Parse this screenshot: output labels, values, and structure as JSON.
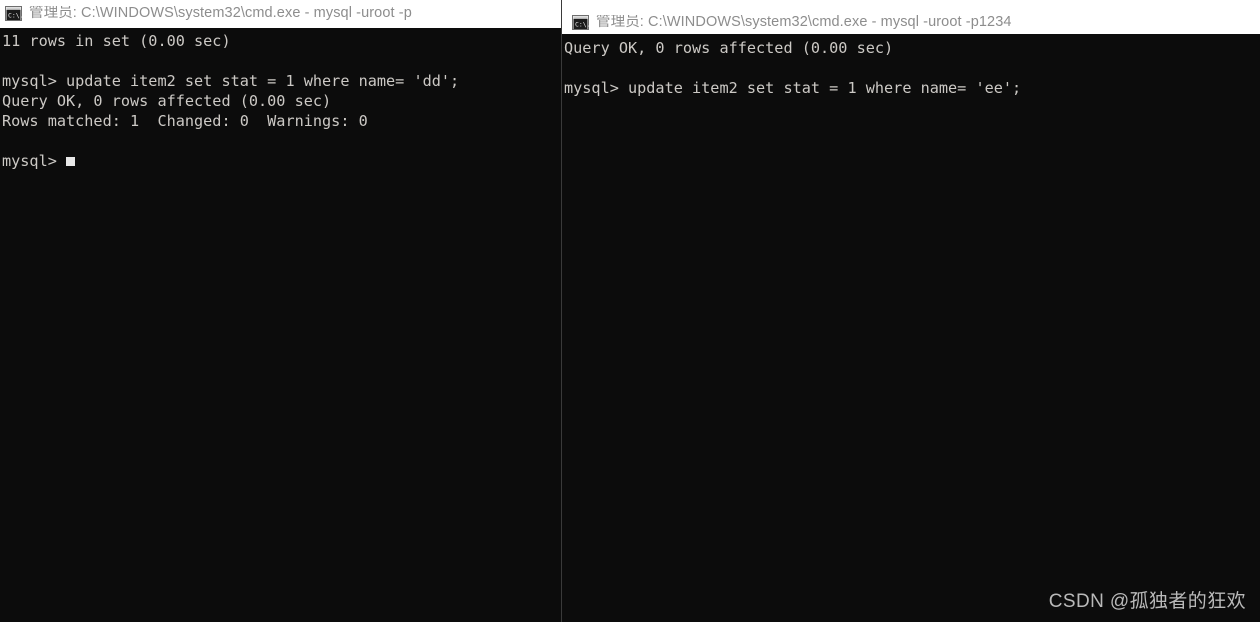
{
  "colors": {
    "console_bg": "#0c0c0c",
    "console_text": "#ccc9c5",
    "titlebar_bg": "#ffffff",
    "titlebar_text": "#8d8d8d",
    "accent_blue": "#0078d7",
    "accent_gray": "#a6a6a6",
    "divider": "#3a3a3a",
    "cursor": "#e8e8e8",
    "watermark_text": "#b9b9b9"
  },
  "windows": {
    "left": {
      "icon_name": "cmd-exe-icon",
      "title": "管理员: C:\\WINDOWS\\system32\\cmd.exe - mysql  -uroot -p",
      "console_lines": [
        "11 rows in set (0.00 sec)",
        "",
        "mysql> update item2 set stat = 1 where name= 'dd';",
        "Query OK, 0 rows affected (0.00 sec)",
        "Rows matched: 1  Changed: 0  Warnings: 0",
        "",
        "mysql> "
      ],
      "cursor_visible": true
    },
    "right": {
      "icon_name": "cmd-exe-icon",
      "title": "管理员: C:\\WINDOWS\\system32\\cmd.exe - mysql  -uroot -p1234",
      "console_lines": [
        "Query OK, 0 rows affected (0.00 sec)",
        "",
        "mysql> update item2 set stat = 1 where name= 'ee';"
      ],
      "cursor_visible": false
    }
  },
  "watermark": {
    "text": "CSDN @孤独者的狂欢"
  }
}
